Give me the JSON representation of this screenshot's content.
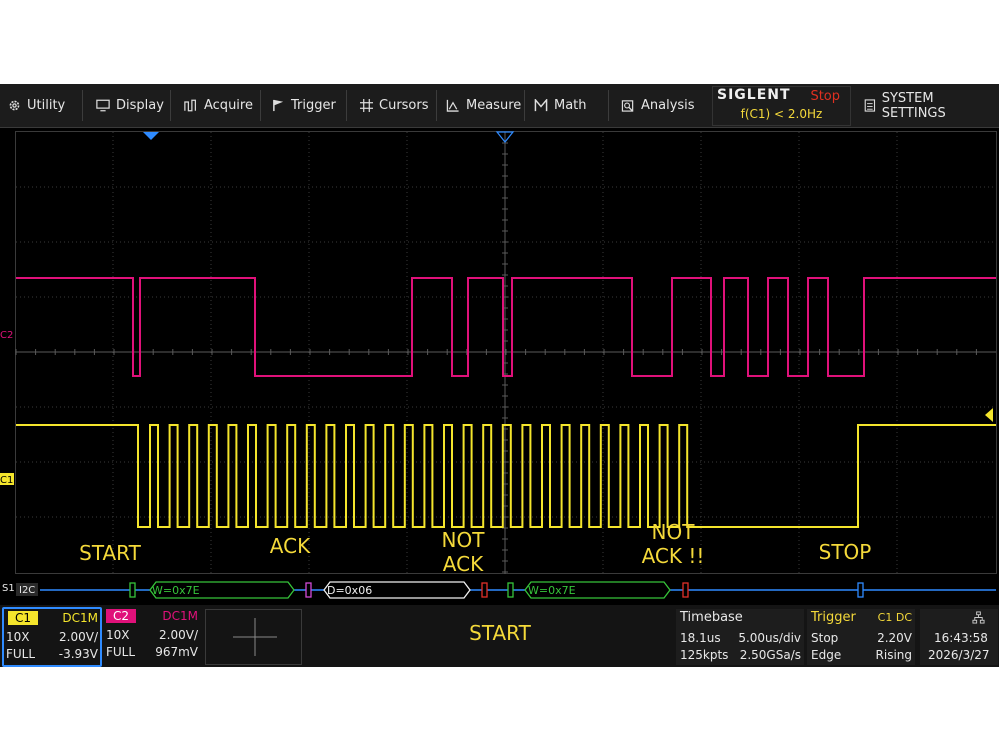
{
  "menu": [
    {
      "label": "Utility",
      "icon": "gear-icon"
    },
    {
      "label": "Display",
      "icon": "monitor-icon"
    },
    {
      "label": "Acquire",
      "icon": "acquire-icon"
    },
    {
      "label": "Trigger",
      "icon": "flag-icon"
    },
    {
      "label": "Cursors",
      "icon": "cursor-cross-icon"
    },
    {
      "label": "Measure",
      "icon": "measure-icon"
    },
    {
      "label": "Math",
      "icon": "math-icon"
    },
    {
      "label": "Analysis",
      "icon": "analysis-icon"
    }
  ],
  "brand": {
    "name": "SIGLENT",
    "state": "Stop",
    "freq": "f(C1) < 2.0Hz"
  },
  "system_settings": "SYSTEM SETTINGS",
  "channel_markers": {
    "c2": "C2",
    "c1": "C1"
  },
  "annotations": [
    "START",
    "ACK",
    "NOT\nACK",
    "NOT\nACK !!",
    "STOP"
  ],
  "decode": {
    "bus": "S1",
    "protocol": "I2C",
    "frames": [
      "W=0x7E",
      "D=0x06",
      "W=0x7E"
    ]
  },
  "c1": {
    "name": "C1",
    "coupling": "DC1M",
    "probe": "10X",
    "scale": "2.00V/",
    "bw": "FULL",
    "offset": "-3.93V"
  },
  "c2": {
    "name": "C2",
    "coupling": "DC1M",
    "probe": "10X",
    "scale": "2.00V/",
    "bw": "FULL",
    "offset": "967mV"
  },
  "status_message": "START",
  "timebase": {
    "title": "Timebase",
    "delay": "18.1us",
    "scale": "5.00us/div",
    "points": "125kpts",
    "rate": "2.50GSa/s"
  },
  "trigger": {
    "title": "Trigger",
    "source": "C1 DC",
    "mode": "Stop",
    "level": "2.20V",
    "type": "Edge",
    "slope": "Rising"
  },
  "clock": {
    "time": "16:43:58",
    "date": "2026/3/27"
  },
  "colors": {
    "c1": "#f4e52c",
    "c2": "#e0117a",
    "decode_ok": "#36c43a",
    "accent": "#2f8bff"
  }
}
